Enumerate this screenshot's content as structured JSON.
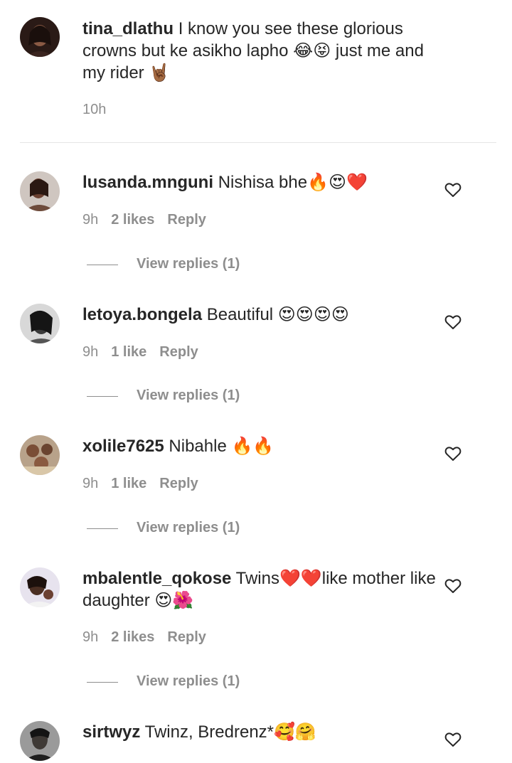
{
  "caption": {
    "username": "tina_dlathu",
    "text": "I know you see these glorious crowns but ke asikho lapho 😂😝 just me and my rider 🤘🏾",
    "time": "10h"
  },
  "comments": [
    {
      "username": "lusanda.mnguni",
      "text": "Nishisa bhe🔥😍❤️",
      "time": "9h",
      "likes": "2 likes",
      "reply": "Reply",
      "view_replies": "View replies (1)"
    },
    {
      "username": "letoya.bongela",
      "text": "Beautiful 😍😍😍😍",
      "time": "9h",
      "likes": "1 like",
      "reply": "Reply",
      "view_replies": "View replies (1)"
    },
    {
      "username": "xolile7625",
      "text": "Nibahle 🔥🔥",
      "time": "9h",
      "likes": "1 like",
      "reply": "Reply",
      "view_replies": "View replies (1)"
    },
    {
      "username": "mbalentle_qokose",
      "text": "Twins❤️❤️like mother like daughter 😍🌺",
      "time": "9h",
      "likes": "2 likes",
      "reply": "Reply",
      "view_replies": "View replies (1)"
    },
    {
      "username": "sirtwyz",
      "text": "Twinz, Bredrenz*🥰🤗"
    }
  ],
  "icons": {
    "like": "heart-outline-icon"
  }
}
